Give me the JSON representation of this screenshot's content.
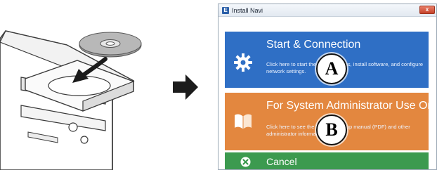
{
  "window": {
    "title": "Install Navi",
    "app_icon_letter": "E",
    "close_glyph": "x"
  },
  "panels": {
    "start": {
      "title": "Start & Connection",
      "description": "Click here to start the setup process, install software, and configure network settings.",
      "icon": "gear-icon",
      "color": "#2f6fc5"
    },
    "admin": {
      "title": "For System Administrator Use Only",
      "description": "Click here to see the hardware setup manual (PDF) and other administrator information.",
      "icon": "open-book-icon",
      "color": "#e3873f"
    },
    "cancel": {
      "label": "Cancel",
      "icon": "close-circle-icon",
      "color": "#3c9a4f"
    }
  },
  "callouts": {
    "a": "A",
    "b": "B"
  },
  "illustration": {
    "subject": "computer-tower-with-disc-tray",
    "arrow": "right-arrow-icon"
  }
}
